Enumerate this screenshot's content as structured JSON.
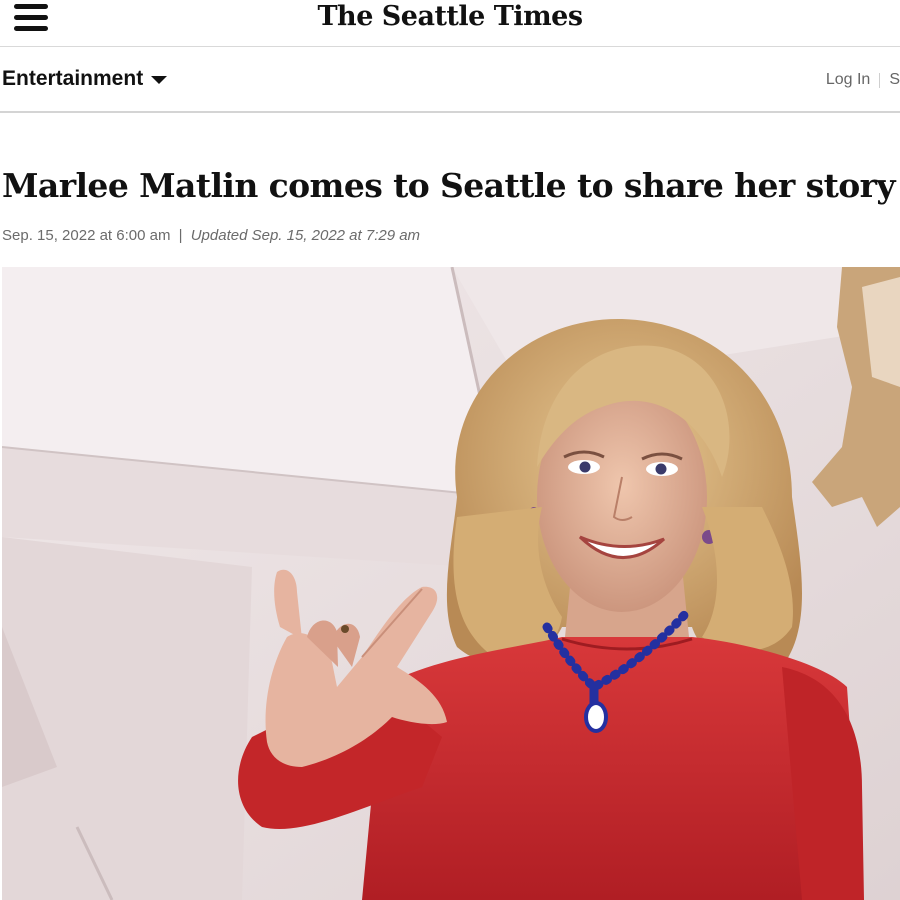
{
  "header": {
    "logo_text": "The Seattle Times",
    "menu_icon": "hamburger-menu-icon"
  },
  "section_bar": {
    "section_label": "Entertainment",
    "dropdown_icon": "chevron-down-icon",
    "login_label": "Log In",
    "subscribe_label_partial": "S"
  },
  "article": {
    "headline": "Marlee Matlin comes to Seattle to share her story",
    "published": "Sep. 15, 2022 at 6:00 am",
    "separator": "|",
    "updated": "Updated Sep. 15, 2022 at 7:29 am"
  },
  "colors": {
    "dress": "#c8282a",
    "background_wall": "#e9dfdf",
    "necklace": "#2430a0",
    "hair": "#d8b27a"
  }
}
